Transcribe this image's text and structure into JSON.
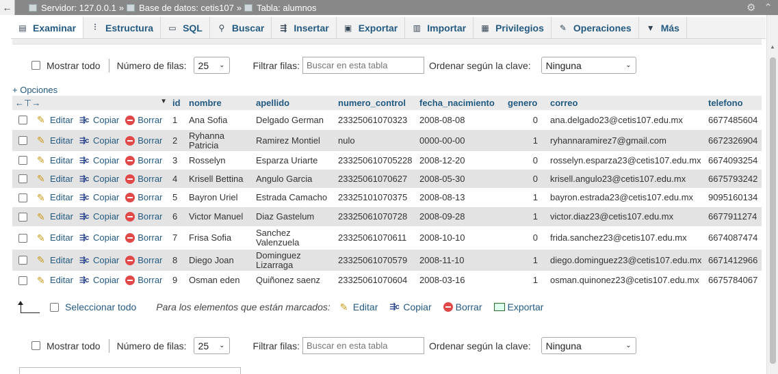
{
  "breadcrumb": {
    "server": "Servidor: 127.0.0.1",
    "database": "Base de datos: cetis107",
    "table": "Tabla: alumnos",
    "sep": "»"
  },
  "tabs": [
    "Examinar",
    "Estructura",
    "SQL",
    "Buscar",
    "Insertar",
    "Exportar",
    "Importar",
    "Privilegios",
    "Operaciones",
    "Más"
  ],
  "controls": {
    "show_all": "Mostrar todo",
    "num_rows_label": "Número de filas:",
    "num_rows_value": "25",
    "filter_label": "Filtrar filas:",
    "filter_placeholder": "Buscar en esta tabla",
    "sort_label": "Ordenar según la clave:",
    "sort_value": "Ninguna"
  },
  "options_link": "+ Opciones",
  "actions": {
    "edit": "Editar",
    "copy": "Copiar",
    "delete": "Borrar"
  },
  "columns": [
    "id",
    "nombre",
    "apellido",
    "numero_control",
    "fecha_nacimiento",
    "genero",
    "correo",
    "telefono"
  ],
  "rows": [
    {
      "id": "1",
      "nombre": "Ana Sofia",
      "apellido": "Delgado German",
      "numero_control": "23325061070323",
      "fecha_nacimiento": "2008-08-08",
      "genero": "0",
      "correo": "ana.delgado23@cetis107.edu.mx",
      "telefono": "6677485604"
    },
    {
      "id": "2",
      "nombre": "Ryhanna Patricia",
      "apellido": "Ramirez Montiel",
      "numero_control": "nulo",
      "fecha_nacimiento": "0000-00-00",
      "genero": "1",
      "correo": "ryhannaramirez7@gmail.com",
      "telefono": "6672326904"
    },
    {
      "id": "3",
      "nombre": "Rosselyn",
      "apellido": "Esparza Uriarte",
      "numero_control": "233250610705228",
      "fecha_nacimiento": "2008-12-20",
      "genero": "0",
      "correo": "rosselyn.esparza23@cetis107.edu.mx",
      "telefono": "6674093254"
    },
    {
      "id": "4",
      "nombre": "Krisell Bettina",
      "apellido": "Angulo Garcia",
      "numero_control": "23325061070627",
      "fecha_nacimiento": "2008-05-30",
      "genero": "0",
      "correo": "krisell.angulo23@cetis107.edu.mx",
      "telefono": "6675793242"
    },
    {
      "id": "5",
      "nombre": "Bayron Uriel",
      "apellido": "Estrada Camacho",
      "numero_control": "23325101070375",
      "fecha_nacimiento": "2008-08-13",
      "genero": "1",
      "correo": "bayron.estrada23@cetis107.edu.mx",
      "telefono": "9095160134"
    },
    {
      "id": "6",
      "nombre": "Victor Manuel",
      "apellido": "Diaz Gastelum",
      "numero_control": "23325061070728",
      "fecha_nacimiento": "2008-09-28",
      "genero": "1",
      "correo": "victor.diaz23@cetis107.edu.mx",
      "telefono": "6677911274"
    },
    {
      "id": "7",
      "nombre": "Frisa Sofia",
      "apellido": "Sanchez Valenzuela",
      "numero_control": "23325061070611",
      "fecha_nacimiento": "2008-10-10",
      "genero": "0",
      "correo": "frida.sanchez23@cetis107.edu.mx",
      "telefono": "6674087474"
    },
    {
      "id": "8",
      "nombre": "Diego Joan",
      "apellido": "Dominguez Lizarraga",
      "numero_control": "23325061070579",
      "fecha_nacimiento": "2008-11-10",
      "genero": "1",
      "correo": "diego.dominguez23@cetis107.edu.mx",
      "telefono": "6671412966"
    },
    {
      "id": "9",
      "nombre": "Osman eden",
      "apellido": "Quiñonez saenz",
      "numero_control": "23325061070604",
      "fecha_nacimiento": "2008-03-16",
      "genero": "1",
      "correo": "osman.quinonez23@cetis107.edu.mx",
      "telefono": "6675784067"
    }
  ],
  "bulk": {
    "select_all": "Seleccionar todo",
    "note": "Para los elementos que están marcados:",
    "edit": "Editar",
    "copy": "Copiar",
    "delete": "Borrar",
    "export": "Exportar"
  },
  "colors": {
    "link": "#235a81",
    "header_bg": "#eaeaea",
    "stripe": "#e3e3e3",
    "topbar": "#888888"
  },
  "icons": [
    "browse-icon",
    "structure-icon",
    "sql-icon",
    "search-icon",
    "insert-icon",
    "export-icon",
    "import-icon",
    "privileges-icon",
    "operations-icon",
    "chevron-down-icon",
    "pencil-icon",
    "copy-icon",
    "delete-icon",
    "settings-icon",
    "collapse-icon"
  ]
}
